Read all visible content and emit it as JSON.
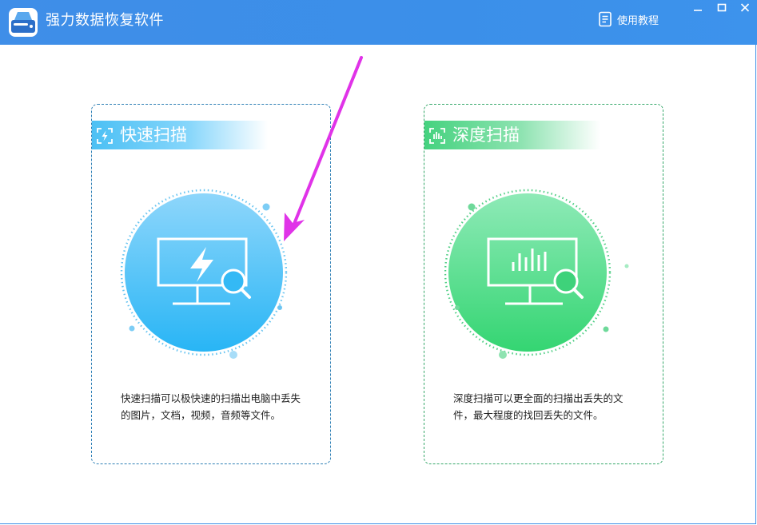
{
  "app": {
    "title": "强力数据恢复软件",
    "help_label": "使用教程"
  },
  "colors": {
    "titlebar": "#3d8fe9",
    "quick_accent": "#2db8f6",
    "deep_accent": "#3fd878",
    "annotation_arrow": "#e033e8"
  },
  "window_controls": [
    "minimize-icon",
    "maximize-icon",
    "close-icon"
  ],
  "cards": {
    "quick": {
      "title": "快速扫描",
      "icon": "quick-scan-icon",
      "illustration": "monitor-lightning-magnifier-icon",
      "description": "快速扫描可以极快速的扫描出电脑中丢失的图片，文档，视频，音频等文件。"
    },
    "deep": {
      "title": "深度扫描",
      "icon": "deep-scan-icon",
      "illustration": "monitor-bars-magnifier-icon",
      "description": "深度扫描可以更全面的扫描出丢失的文件，最大程度的找回丢失的文件。"
    }
  }
}
